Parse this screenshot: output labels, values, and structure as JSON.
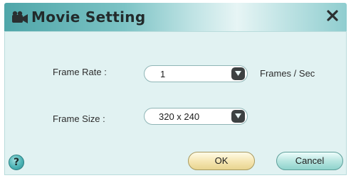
{
  "window": {
    "title": "Movie Setting"
  },
  "frame_rate": {
    "label": "Frame Rate :",
    "value": "1",
    "unit": "Frames / Sec"
  },
  "frame_size": {
    "label": "Frame Size :",
    "value": "320 x 240"
  },
  "buttons": {
    "help": "?",
    "ok": "OK",
    "cancel": "Cancel"
  },
  "colors": {
    "title_bar": "#7cc3c5",
    "panel_background": "#e1f2f2",
    "ok_button": "#f6e7b4",
    "cancel_button": "#b8e6e1"
  },
  "icons": {
    "title": "movie-camera-icon",
    "close": "close-icon",
    "dropdown": "chevron-down-icon"
  }
}
